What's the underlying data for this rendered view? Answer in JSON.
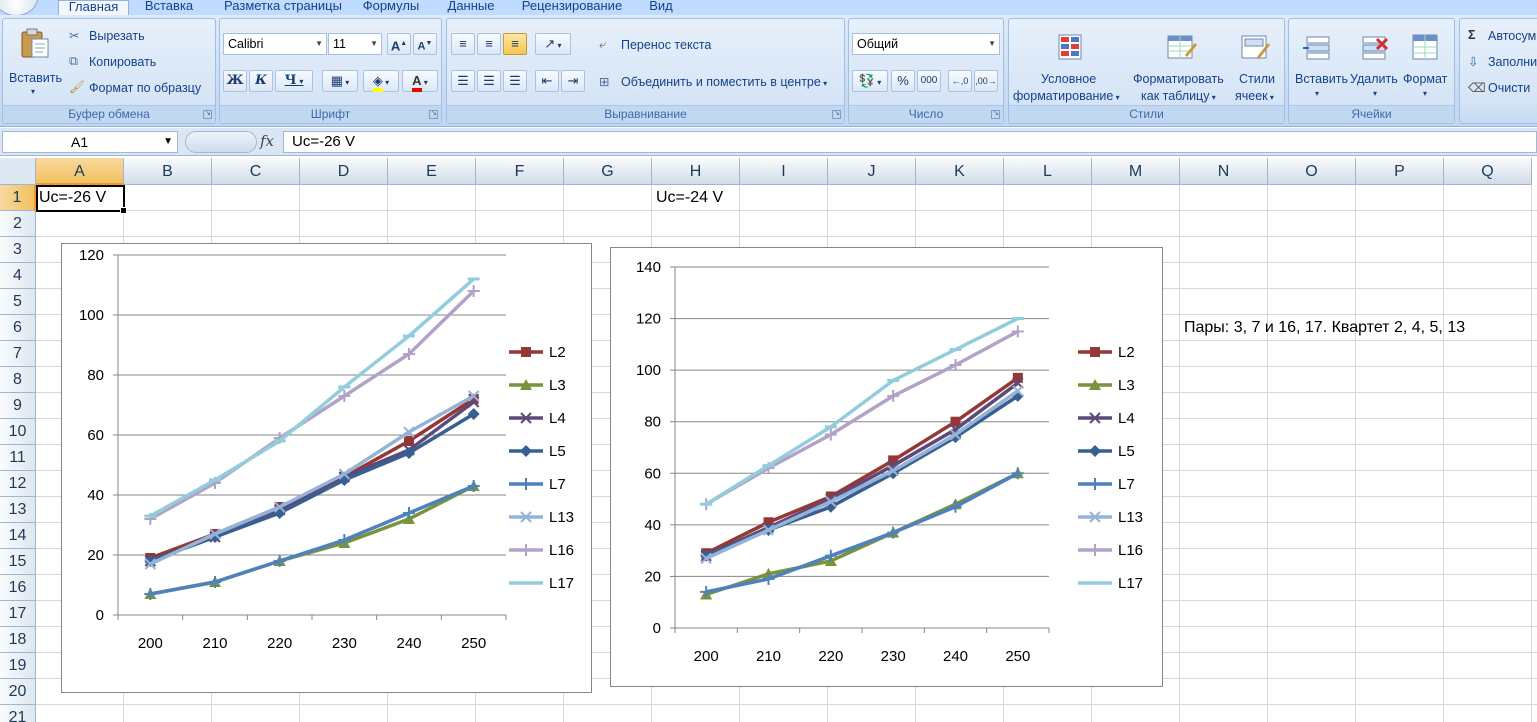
{
  "ribbon": {
    "tabs": [
      "Главная",
      "Вставка",
      "Разметка страницы",
      "Формулы",
      "Данные",
      "Рецензирование",
      "Вид"
    ],
    "clipboard": {
      "paste": "Вставить",
      "cut": "Вырезать",
      "copy": "Копировать",
      "format_painter": "Формат по образцу",
      "group": "Буфер обмена"
    },
    "font": {
      "name": "Calibri",
      "size": "11",
      "bold": "Ж",
      "italic": "К",
      "underline": "Ч",
      "grow": "A",
      "shrink": "A",
      "group": "Шрифт"
    },
    "alignment": {
      "wrap": "Перенос текста",
      "merge": "Объединить и поместить в центре",
      "group": "Выравнивание"
    },
    "number": {
      "format": "Общий",
      "percent": "%",
      "thousands": "000",
      "group": "Число"
    },
    "styles": {
      "conditional_1": "Условное",
      "conditional_2": "форматирование",
      "table_1": "Форматировать",
      "table_2": "как таблицу",
      "cell_1": "Стили",
      "cell_2": "ячеек",
      "group": "Стили"
    },
    "cells": {
      "insert": "Вставить",
      "delete": "Удалить",
      "format": "Формат",
      "group": "Ячейки"
    },
    "editing": {
      "autosum": "Автосум",
      "fill": "Заполни",
      "clear": "Очисти"
    }
  },
  "formula_bar": {
    "name_box": "A1",
    "fx": "fx",
    "formula": "Uc=-26 V"
  },
  "sheet": {
    "columns": [
      "A",
      "B",
      "C",
      "D",
      "E",
      "F",
      "G",
      "H",
      "I",
      "J",
      "K",
      "L",
      "M",
      "N",
      "O",
      "P",
      "Q"
    ],
    "rows": [
      "1",
      "2",
      "3",
      "4",
      "5",
      "6",
      "7",
      "8",
      "9",
      "10",
      "11",
      "12",
      "13",
      "14",
      "15",
      "16",
      "17",
      "18",
      "19",
      "20",
      "21"
    ],
    "a1": "Uc=-26 V",
    "h1": "Uc=-24 V",
    "n6": "Пары: 3, 7 и 16, 17. Квартет 2, 4, 5, 13"
  },
  "chart_data": [
    {
      "type": "line",
      "categories": [
        200,
        210,
        220,
        230,
        240,
        250
      ],
      "ylim": [
        0,
        120
      ],
      "yticks": [
        0,
        20,
        40,
        60,
        80,
        100,
        120
      ],
      "grid": true,
      "legend": "right",
      "series": [
        {
          "name": "L2",
          "color": "#953735",
          "marker": "square",
          "values": [
            19,
            27,
            36,
            46,
            58,
            72
          ]
        },
        {
          "name": "L3",
          "color": "#77933c",
          "marker": "triangle",
          "values": [
            7,
            11,
            18,
            24,
            32,
            43
          ]
        },
        {
          "name": "L4",
          "color": "#5f497a",
          "marker": "x",
          "values": [
            18,
            26,
            35,
            46,
            55,
            71
          ]
        },
        {
          "name": "L5",
          "color": "#376092",
          "marker": "diamond",
          "values": [
            18,
            26,
            34,
            45,
            54,
            67
          ]
        },
        {
          "name": "L7",
          "color": "#4f81bd",
          "marker": "plus",
          "values": [
            7,
            11,
            18,
            25,
            34,
            43
          ]
        },
        {
          "name": "L13",
          "color": "#95b3d7",
          "marker": "x",
          "values": [
            17,
            27,
            36,
            47,
            61,
            73
          ]
        },
        {
          "name": "L16",
          "color": "#b3a2c7",
          "marker": "plus",
          "values": [
            32,
            44,
            59,
            73,
            87,
            108
          ]
        },
        {
          "name": "L17",
          "color": "#93cddd",
          "marker": "dash",
          "values": [
            33,
            45,
            58,
            76,
            93,
            112
          ]
        }
      ]
    },
    {
      "type": "line",
      "categories": [
        200,
        210,
        220,
        230,
        240,
        250
      ],
      "ylim": [
        0,
        140
      ],
      "yticks": [
        0,
        20,
        40,
        60,
        80,
        100,
        120,
        140
      ],
      "grid": true,
      "legend": "right",
      "series": [
        {
          "name": "L2",
          "color": "#953735",
          "marker": "square",
          "values": [
            29,
            41,
            51,
            65,
            80,
            97
          ]
        },
        {
          "name": "L3",
          "color": "#77933c",
          "marker": "triangle",
          "values": [
            13,
            21,
            26,
            37,
            48,
            60
          ]
        },
        {
          "name": "L4",
          "color": "#5f497a",
          "marker": "x",
          "values": [
            28,
            39,
            50,
            63,
            77,
            95
          ]
        },
        {
          "name": "L5",
          "color": "#376092",
          "marker": "diamond",
          "values": [
            28,
            38,
            47,
            60,
            74,
            90
          ]
        },
        {
          "name": "L7",
          "color": "#4f81bd",
          "marker": "plus",
          "values": [
            14,
            19,
            28,
            37,
            47,
            60
          ]
        },
        {
          "name": "L13",
          "color": "#95b3d7",
          "marker": "x",
          "values": [
            27,
            38,
            49,
            61,
            75,
            92
          ]
        },
        {
          "name": "L16",
          "color": "#b3a2c7",
          "marker": "plus",
          "values": [
            48,
            62,
            75,
            90,
            102,
            115
          ]
        },
        {
          "name": "L17",
          "color": "#93cddd",
          "marker": "dash",
          "values": [
            48,
            63,
            78,
            96,
            108,
            120
          ]
        }
      ]
    }
  ]
}
